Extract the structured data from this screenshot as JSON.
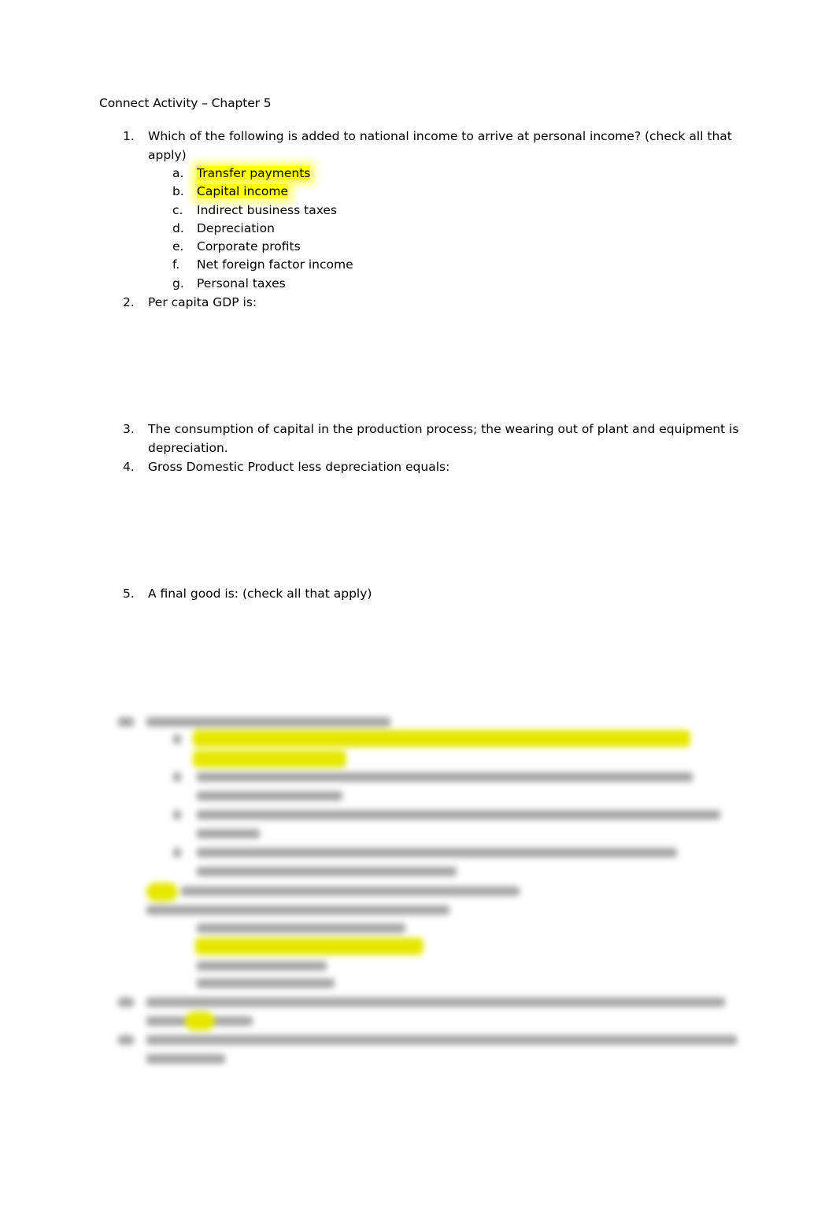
{
  "document": {
    "title": "Connect Activity – Chapter 5",
    "questions": [
      {
        "number": "1.",
        "text": "Which of the following is added to national income to arrive at personal income?  (check all that apply)",
        "options": [
          {
            "letter": "a.",
            "text": "Transfer payments",
            "highlighted": true
          },
          {
            "letter": "b.",
            "text": "Capital income",
            "highlighted": true
          },
          {
            "letter": "c.",
            "text": "Indirect business taxes",
            "highlighted": false
          },
          {
            "letter": "d.",
            "text": "Depreciation",
            "highlighted": false
          },
          {
            "letter": "e.",
            "text": "Corporate profits",
            "highlighted": false
          },
          {
            "letter": "f.",
            "text": "Net foreign factor income",
            "highlighted": false
          },
          {
            "letter": "g.",
            "text": "Personal taxes",
            "highlighted": false
          }
        ]
      },
      {
        "number": "2.",
        "text": "Per capita GDP is:"
      },
      {
        "number": "3.",
        "text": "The consumption of capital in the production process; the wearing out of plant and equipment is depreciation."
      },
      {
        "number": "4.",
        "text": "Gross Domestic Product less depreciation equals:"
      },
      {
        "number": "5.",
        "text": "A final good is:     (check all that apply)"
      }
    ],
    "blurred_section_note": "Remaining content (questions 6–10) is blurred and unreadable",
    "highlight_color": "#ffff00"
  }
}
